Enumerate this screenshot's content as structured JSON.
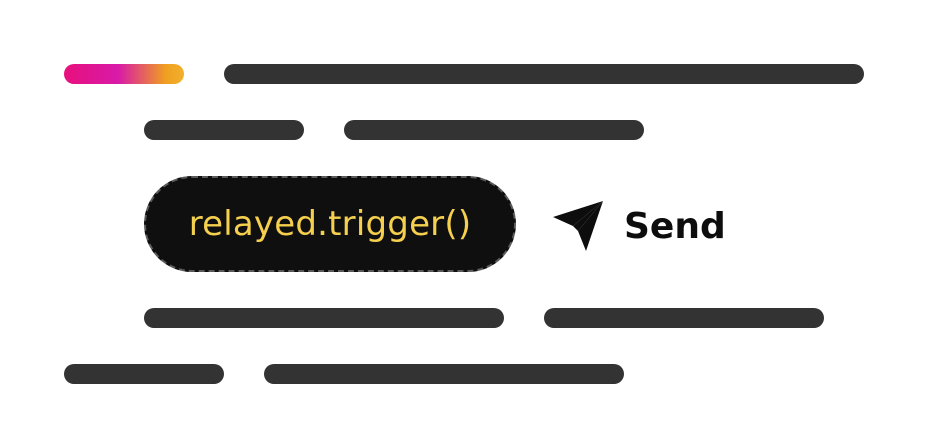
{
  "code": {
    "text": "relayed.trigger()"
  },
  "send": {
    "label": "Send",
    "icon": "send-icon"
  },
  "colors": {
    "placeholder_bar": "#333333",
    "code_background": "#0f0f0f",
    "code_text": "#f5cf4e",
    "accent_start": "#e8107c",
    "accent_end": "#f2b02c"
  }
}
